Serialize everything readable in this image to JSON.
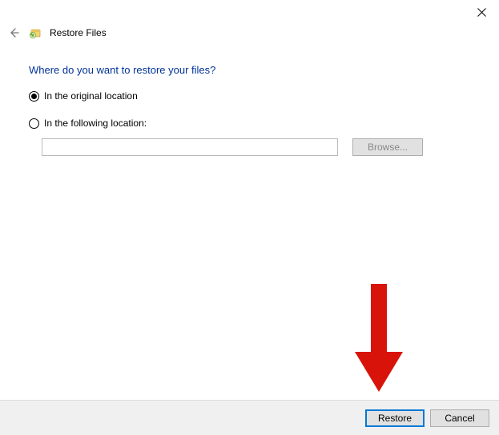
{
  "window": {
    "title": "Restore Files"
  },
  "heading": "Where do you want to restore your files?",
  "options": {
    "original": "In the original location",
    "following": "In the following location:"
  },
  "path_value": "",
  "browse_label": "Browse...",
  "footer": {
    "restore": "Restore",
    "cancel": "Cancel"
  }
}
